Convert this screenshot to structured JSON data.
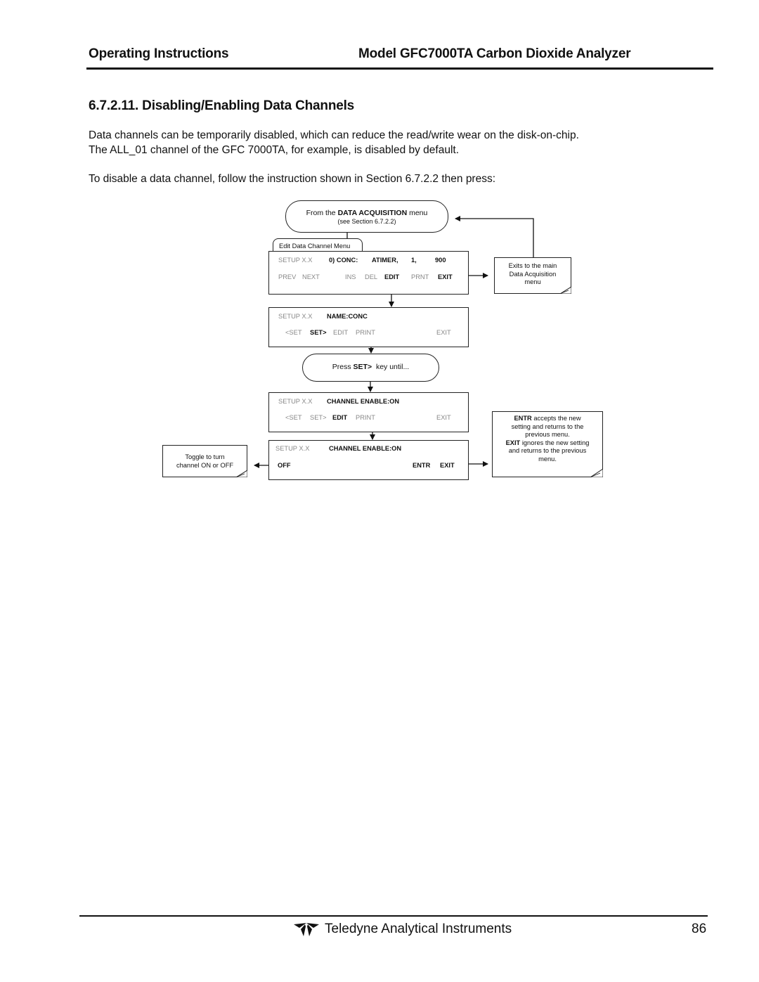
{
  "header": {
    "left": "Operating Instructions",
    "right": "Model GFC7000TA Carbon Dioxide Analyzer"
  },
  "section": {
    "title": "6.7.2.11. Disabling/Enabling Data Channels",
    "paragraph1_line1": "Data channels can be temporarily disabled, which can reduce the read/write wear on the disk-on-chip.",
    "paragraph1_line2": "The ALL_01 channel of the GFC 7000TA, for example, is disabled by default.",
    "paragraph2": "To disable a data channel, follow the instruction shown in Section 6.7.2.2 then press:"
  },
  "diagram": {
    "start": {
      "prefix": "From the ",
      "bold": "DATA ACQUISITION",
      "suffix": " menu",
      "sub": "(see Section 6.7.2.2)"
    },
    "tab_label": "Edit Data Channel Menu",
    "screen1": {
      "setup": "SETUP X.X",
      "field1": "0) CONC:",
      "field2": "ATIMER,",
      "field3": "1,",
      "field4": "900",
      "keys": [
        "PREV",
        "NEXT",
        "INS",
        "DEL",
        "EDIT",
        "PRNT",
        "EXIT"
      ]
    },
    "note_exit": [
      "Exits to the main",
      "Data Acquisition",
      "menu"
    ],
    "screen2": {
      "setup": "SETUP X.X",
      "field": "NAME:CONC",
      "keys": [
        "<SET",
        "SET>",
        "EDIT",
        "PRINT",
        "EXIT"
      ]
    },
    "press": {
      "prefix": "Press ",
      "bold": "SET>",
      "suffix": "  key until..."
    },
    "screen3": {
      "setup": "SETUP X.X",
      "field": "CHANNEL ENABLE:ON",
      "keys": [
        "<SET",
        "SET>",
        "EDIT",
        "PRINT",
        "EXIT"
      ]
    },
    "screen4": {
      "setup": "SETUP X.X",
      "field": "CHANNEL ENABLE:ON",
      "keys": [
        "OFF",
        "ENTR",
        "EXIT"
      ]
    },
    "note_toggle": [
      "Toggle to turn",
      "channel ON or OFF"
    ],
    "note_entr": {
      "entr_bold": "ENTR",
      "entr_rest1": " accepts the new",
      "entr_rest2": "setting and returns to the",
      "entr_rest3": "previous menu.",
      "exit_bold": "EXIT",
      "exit_rest1": " ignores the new setting",
      "exit_rest2": "and returns to the previous",
      "exit_rest3": "menu."
    }
  },
  "footer": {
    "company": "Teledyne Analytical Instruments",
    "page_number": "86",
    "logo_icon": "teledyne-logo"
  }
}
